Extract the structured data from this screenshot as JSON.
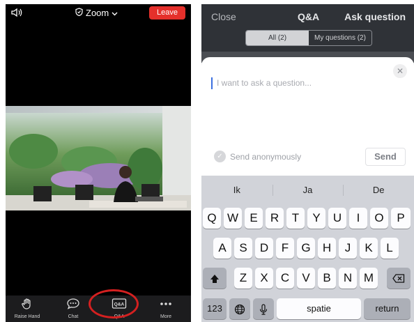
{
  "left": {
    "topbar": {
      "speaker_icon": "speaker-icon",
      "title": "Zoom",
      "title_icon": "shield-icon",
      "leave_label": "Leave",
      "leave_color": "#e5302b"
    },
    "toolbar": {
      "items": [
        {
          "label": "Raise Hand",
          "icon": "hand-icon"
        },
        {
          "label": "Chat",
          "icon": "chat-icon"
        },
        {
          "label": "Q&A",
          "icon": "qa-icon"
        },
        {
          "label": "More",
          "icon": "more-icon"
        }
      ]
    }
  },
  "right": {
    "header": {
      "close_label": "Close",
      "title": "Q&A",
      "ask_label": "Ask question"
    },
    "tabs": [
      {
        "label": "All (2)",
        "selected": true
      },
      {
        "label": "My questions (2)",
        "selected": false
      }
    ],
    "compose": {
      "placeholder": "I want to ask a question...",
      "anon_label": "Send anonymously",
      "send_label": "Send"
    },
    "keyboard": {
      "suggestions": [
        "Ik",
        "Ja",
        "De"
      ],
      "row1": [
        "Q",
        "W",
        "E",
        "R",
        "T",
        "Y",
        "U",
        "I",
        "O",
        "P"
      ],
      "row2": [
        "A",
        "S",
        "D",
        "F",
        "G",
        "H",
        "J",
        "K",
        "L"
      ],
      "row3": [
        "Z",
        "X",
        "C",
        "V",
        "B",
        "N",
        "M"
      ],
      "numbers_label": "123",
      "space_label": "spatie",
      "return_label": "return"
    }
  },
  "colors": {
    "accent_red": "#e5302b",
    "header_dark": "#2f3237",
    "keyboard_bg": "#d1d3d9"
  }
}
